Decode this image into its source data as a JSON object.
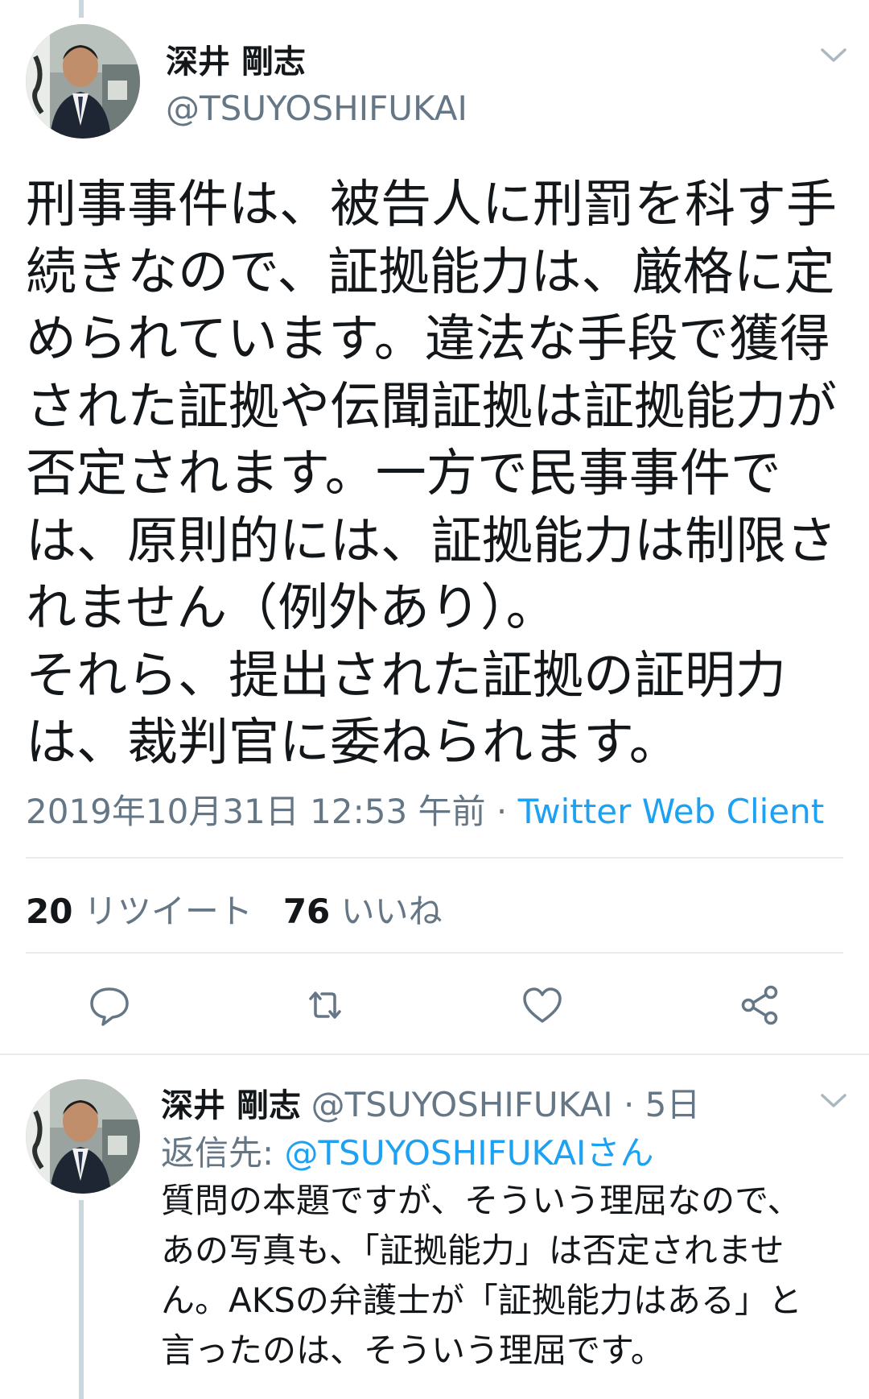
{
  "main_tweet": {
    "author_name": "深井 剛志",
    "author_handle": "@TSUYOSHIFUKAI",
    "text": "刑事事件は、被告人に刑罰を科す手\n続きなので、証拠能力は、厳格に定\nめられています。違法な手段で獲得\nされた証拠や伝聞証拠は証拠能力が\n否定されます。一方で民事事件で\nは、原則的には、証拠能力は制限さ\nれません（例外あり）。\nそれら、提出された証拠の証明力\nは、裁判官に委ねられます。",
    "timestamp": "2019年10月31日 12:53 午前",
    "separator": " · ",
    "source": "Twitter Web Client",
    "retweets_count": "20",
    "retweets_label": "リツイート",
    "likes_count": "76",
    "likes_label": "いいね"
  },
  "actions": [
    {
      "name": "reply-icon"
    },
    {
      "name": "retweet-icon"
    },
    {
      "name": "like-icon"
    },
    {
      "name": "share-icon"
    }
  ],
  "reply_tweet": {
    "author_name": "深井 剛志",
    "author_handle": "@TSUYOSHIFUKAI",
    "separator": " · ",
    "time_ago": "5日",
    "reply_to_label": "返信先: ",
    "reply_to_target": "@TSUYOSHIFUKAIさん",
    "text": "質問の本題ですが、そういう理屈なので、\nあの写真も、「証拠能力」は否定されませ\nん。AKSの弁護士が「証拠能力はある」と\n言ったのは、そういう理屈です。"
  },
  "colors": {
    "text": "#14171a",
    "secondary": "#657786",
    "link": "#1da1f2",
    "divider": "#e6ecf0",
    "thread_line": "#ccd6dd"
  }
}
